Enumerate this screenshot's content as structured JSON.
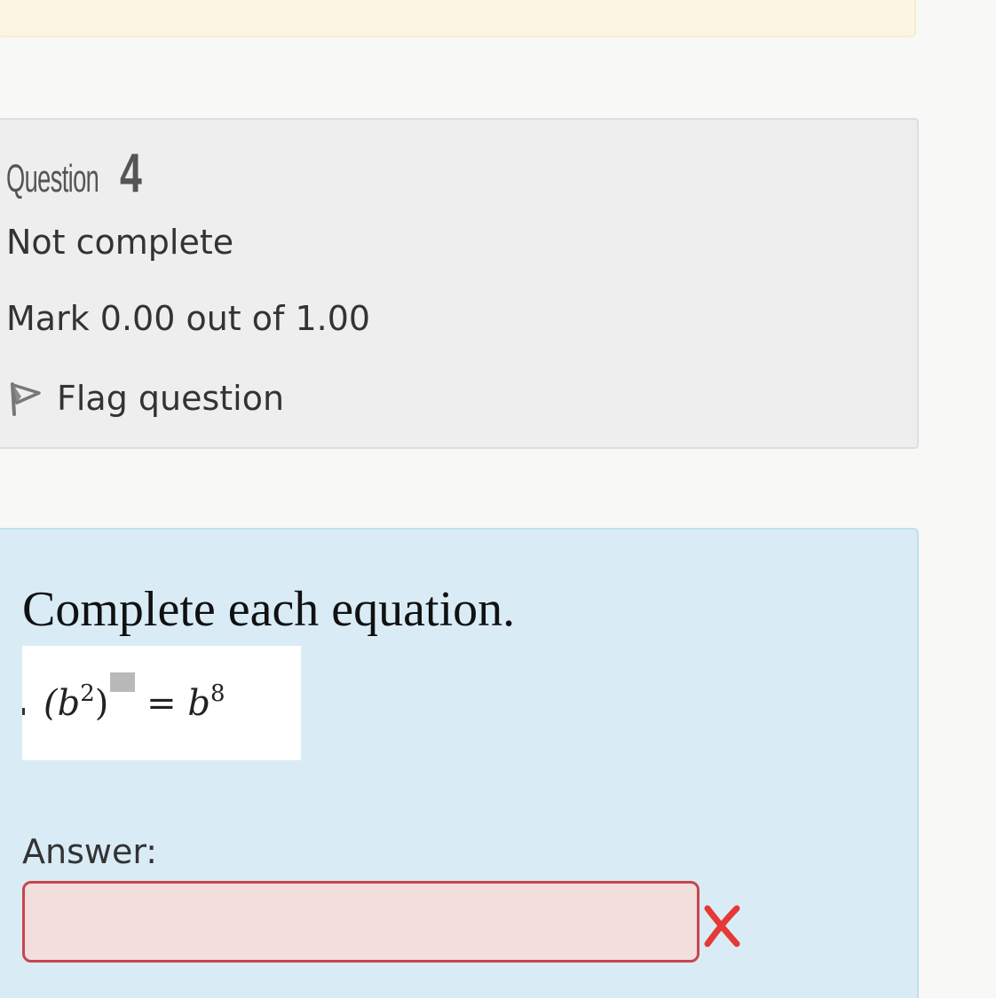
{
  "question_info": {
    "label": "Question",
    "number": "4",
    "state": "Not complete",
    "grade": "Mark 0.00 out of 1.00",
    "flag_label": "Flag question",
    "flag_icon": "flag-outline-icon"
  },
  "question_content": {
    "prompt": "Complete each equation.",
    "equation": {
      "left_open": "(b",
      "inner_exponent": "2",
      "left_close": ")",
      "equals": " = b",
      "right_exponent": "8"
    },
    "answer_label": "Answer:",
    "answer_value": "",
    "result_icon": "incorrect-x-icon"
  },
  "colors": {
    "notice_background": "#fdf5e3",
    "info_background": "#eeeeee",
    "content_background": "#d9ecf6",
    "input_error_border": "#c9454c",
    "input_error_background": "#f3dede",
    "incorrect_mark": "#e53935"
  }
}
